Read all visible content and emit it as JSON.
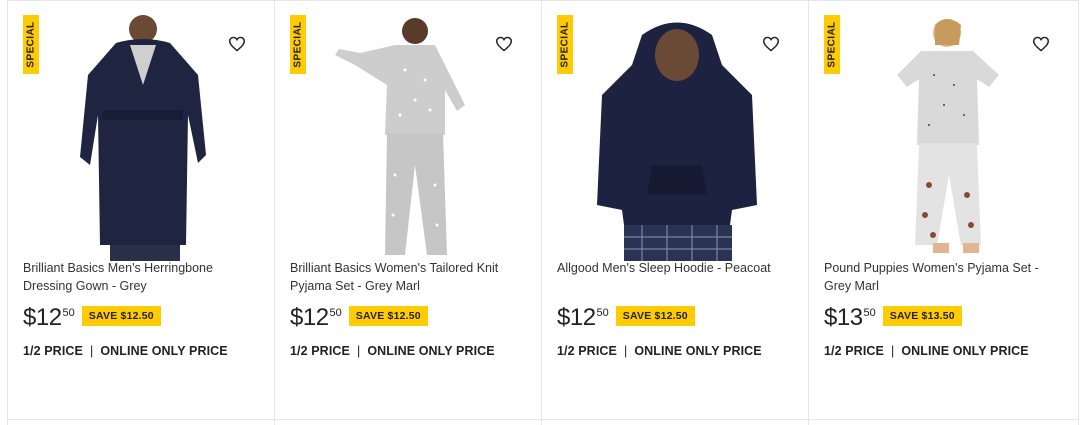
{
  "products": [
    {
      "badge": "SPECIAL",
      "title": "Brilliant Basics Men's Herringbone Dressing Gown - Grey",
      "price_dollars": "$12",
      "price_cents": "50",
      "save": "SAVE $12.50",
      "promo_a": "1/2 PRICE",
      "promo_sep": "|",
      "promo_b": "ONLINE ONLY PRICE",
      "wishlist_icon": "heart-outline"
    },
    {
      "badge": "SPECIAL",
      "title": "Brilliant Basics Women's Tailored Knit Pyjama Set - Grey Marl",
      "price_dollars": "$12",
      "price_cents": "50",
      "save": "SAVE $12.50",
      "promo_a": "1/2 PRICE",
      "promo_sep": "|",
      "promo_b": "ONLINE ONLY PRICE",
      "wishlist_icon": "heart-outline"
    },
    {
      "badge": "SPECIAL",
      "title": "Allgood Men's Sleep Hoodie - Peacoat",
      "price_dollars": "$12",
      "price_cents": "50",
      "save": "SAVE $12.50",
      "promo_a": "1/2 PRICE",
      "promo_sep": "|",
      "promo_b": "ONLINE ONLY PRICE",
      "wishlist_icon": "heart-outline"
    },
    {
      "badge": "SPECIAL",
      "title": "Pound Puppies Women's Pyjama Set - Grey Marl",
      "price_dollars": "$13",
      "price_cents": "50",
      "save": "SAVE $13.50",
      "promo_a": "1/2 PRICE",
      "promo_sep": "|",
      "promo_b": "ONLINE ONLY PRICE",
      "wishlist_icon": "heart-outline"
    }
  ],
  "colors": {
    "badge_yellow": "#ffcb05",
    "navy": "#1c2240",
    "grey_marl": "#c9c9c9"
  }
}
